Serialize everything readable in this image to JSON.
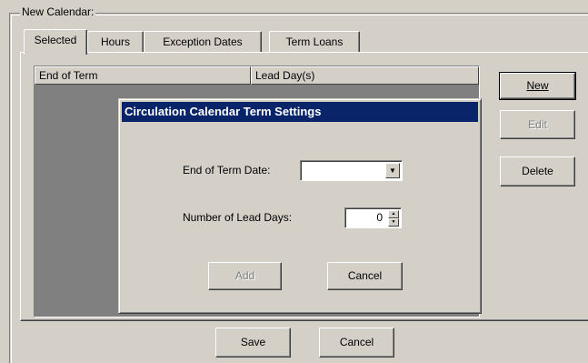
{
  "group": {
    "label": "New Calendar:"
  },
  "tabs": [
    {
      "label": "Selected"
    },
    {
      "label": "Hours"
    },
    {
      "label": "Exception Dates"
    },
    {
      "label": "Term Loans"
    }
  ],
  "list": {
    "columns": [
      "End of Term",
      "Lead Day(s)"
    ]
  },
  "side_buttons": {
    "new": "New",
    "edit": "Edit",
    "delete": "Delete"
  },
  "bottom_buttons": {
    "save": "Save",
    "cancel": "Cancel"
  },
  "dialog": {
    "title": "Circulation Calendar Term Settings",
    "end_of_term_label": "End of Term  Date:",
    "end_of_term_value": "",
    "lead_days_label": "Number of Lead Days:",
    "lead_days_value": "0",
    "add_label": "Add",
    "cancel_label": "Cancel"
  },
  "colors": {
    "titlebar": "#0a246a",
    "face": "#d4d0c8",
    "list_bg": "#808080"
  },
  "icons": {
    "dropdown": "chevron-down-icon",
    "spin_up": "spin-up-icon",
    "spin_down": "spin-down-icon"
  }
}
